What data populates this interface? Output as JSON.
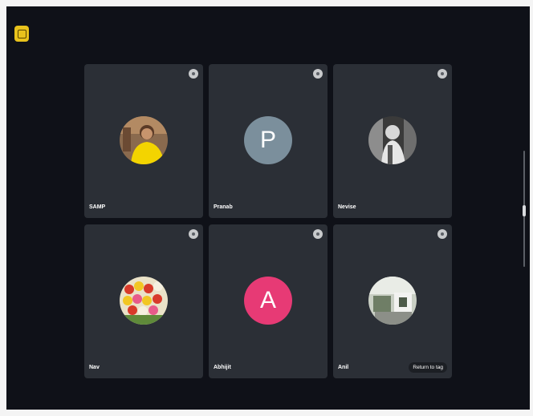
{
  "colors": {
    "background": "#0f1118",
    "tile": "#2b2f36",
    "avatar_p": "#7b8f9c",
    "avatar_a": "#e73a75",
    "corner_button": "#e8c21c"
  },
  "toolbar": {
    "corner_icon": "app-menu-icon"
  },
  "tiles": [
    {
      "name": "SAMP",
      "avatar_type": "photo",
      "avatar_icon": "person-yellow-photo"
    },
    {
      "name": "Pranab",
      "avatar_type": "letter",
      "initial": "P"
    },
    {
      "name": "Nevise",
      "avatar_type": "photo",
      "avatar_icon": "person-bw-photo"
    },
    {
      "name": "Nav",
      "avatar_type": "photo",
      "avatar_icon": "tulips-photo"
    },
    {
      "name": "Abhijit",
      "avatar_type": "letter",
      "initial": "A"
    },
    {
      "name": "Anil",
      "avatar_type": "photo",
      "avatar_icon": "room-photo",
      "action_label": "Return to tag"
    }
  ]
}
